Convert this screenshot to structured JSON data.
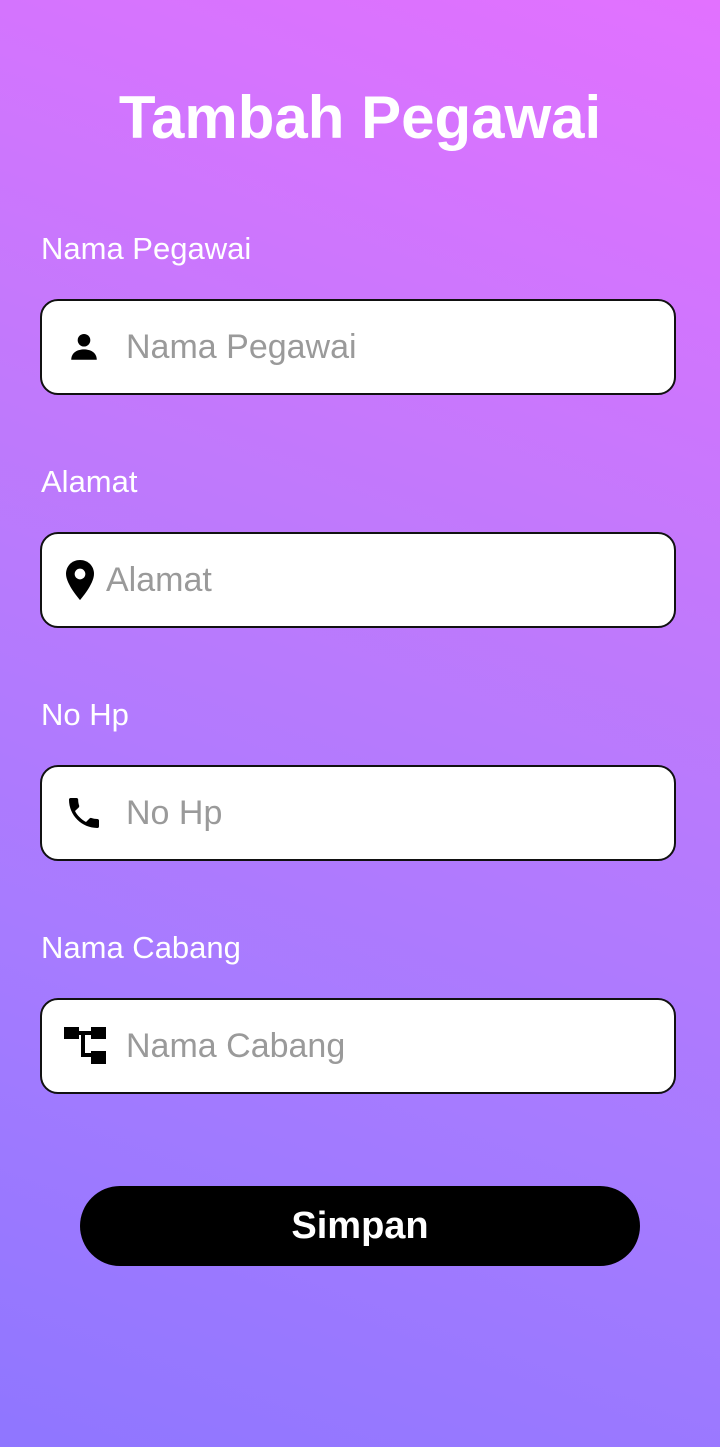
{
  "page": {
    "title": "Tambah Pegawai"
  },
  "form": {
    "fields": [
      {
        "label": "Nama Pegawai",
        "placeholder": "Nama Pegawai",
        "value": "",
        "icon": "person-icon"
      },
      {
        "label": "Alamat",
        "placeholder": "Alamat",
        "value": "",
        "icon": "location-pin-icon"
      },
      {
        "label": "No Hp",
        "placeholder": "No Hp",
        "value": "",
        "icon": "phone-icon"
      },
      {
        "label": "Nama Cabang",
        "placeholder": "Nama Cabang",
        "value": "",
        "icon": "branch-tree-icon"
      }
    ],
    "submit_label": "Simpan"
  },
  "colors": {
    "gradient_top": "#e271ff",
    "gradient_bottom": "#8f76ff",
    "field_background": "#ffffff",
    "button_background": "#000000",
    "text_light": "#ffffff",
    "placeholder": "#9a9a9a"
  }
}
